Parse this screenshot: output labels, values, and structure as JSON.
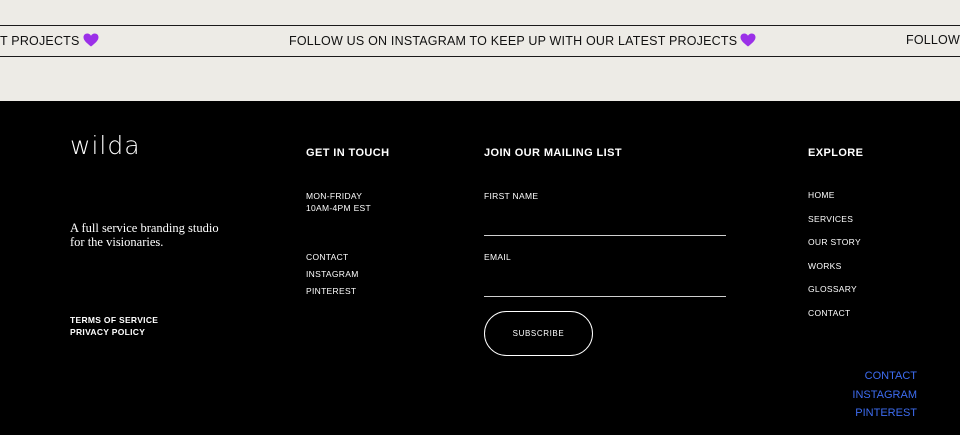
{
  "marquee": {
    "segments": [
      "T PROJECTS",
      "FOLLOW US ON INSTAGRAM TO KEEP UP WITH OUR LATEST PROJECTS",
      "FOLLOW"
    ],
    "heart_icon": "purple-heart-icon",
    "heart_color": "#9b30e8"
  },
  "brand": {
    "logo": "wilda",
    "tagline": "A full service branding studio for the visionaries."
  },
  "legal": {
    "terms": "TERMS OF SERVICE",
    "privacy": "PRIVACY POLICY"
  },
  "get_in_touch": {
    "heading": "GET IN TOUCH",
    "hours_days": "MON-FRIDAY",
    "hours_time": "10AM-4PM EST",
    "links": [
      "CONTACT",
      "INSTAGRAM",
      "PINTEREST"
    ]
  },
  "mailing_list": {
    "heading": "JOIN OUR MAILING LIST",
    "first_name_label": "FIRST NAME",
    "first_name_value": "",
    "email_label": "EMAIL",
    "email_value": "",
    "subscribe_label": "SUBSCRIBE"
  },
  "explore": {
    "heading": "EXPLORE",
    "links": [
      "HOME",
      "SERVICES",
      "OUR STORY",
      "WORKS",
      "GLOSSARY",
      "CONTACT"
    ]
  },
  "social_links": {
    "items": [
      "CONTACT",
      "INSTAGRAM",
      "PINTEREST"
    ],
    "color": "#3d6cf0"
  }
}
